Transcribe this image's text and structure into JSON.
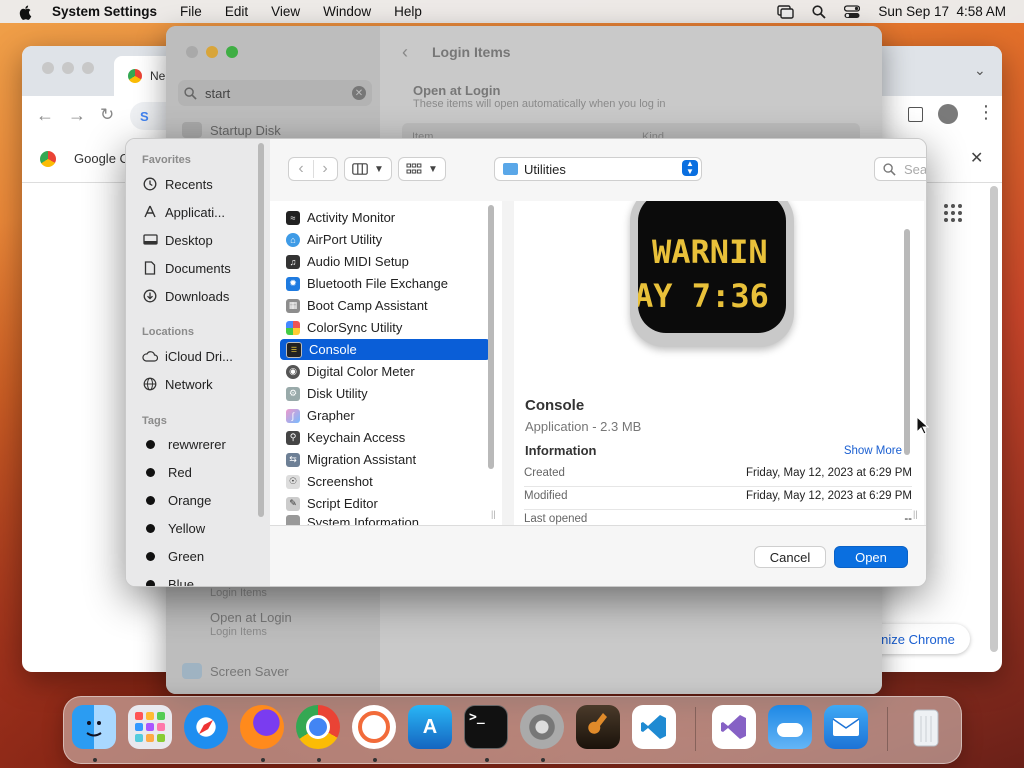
{
  "menubar": {
    "app_name": "System Settings",
    "menus": [
      "File",
      "Edit",
      "View",
      "Window",
      "Help"
    ],
    "datetime": "Sun Sep 17  4:58 AM"
  },
  "chrome": {
    "tab_title": "Ne",
    "bookmark_label": "Google C",
    "address_fragment": "S",
    "customize_button": "nize Chrome"
  },
  "settings": {
    "search_value": "start",
    "sidebar_items": [
      "Startup Disk",
      "Login Items",
      "Open at Login",
      "Login Items",
      "Screen Saver"
    ],
    "header_title": "Login Items",
    "section_title": "Open at Login",
    "section_subtitle": "These items will open automatically when you log in",
    "table_headers": [
      "Item",
      "Kind"
    ]
  },
  "dialog": {
    "sidebar": {
      "favorites_heading": "Favorites",
      "favorites": [
        {
          "label": "Recents",
          "icon": "clock-icon"
        },
        {
          "label": "Applicati...",
          "icon": "applications-icon"
        },
        {
          "label": "Desktop",
          "icon": "desktop-icon"
        },
        {
          "label": "Documents",
          "icon": "document-icon"
        },
        {
          "label": "Downloads",
          "icon": "download-icon"
        }
      ],
      "locations_heading": "Locations",
      "locations": [
        {
          "label": "iCloud Dri...",
          "icon": "cloud-icon"
        },
        {
          "label": "Network",
          "icon": "globe-icon"
        }
      ],
      "tags_heading": "Tags",
      "tags": [
        "rewwrerer",
        "Red",
        "Orange",
        "Yellow",
        "Green",
        "Blue"
      ]
    },
    "toolbar": {
      "location": "Utilities",
      "search_placeholder": "Search"
    },
    "files": [
      "Activity Monitor",
      "AirPort Utility",
      "Audio MIDI Setup",
      "Bluetooth File Exchange",
      "Boot Camp Assistant",
      "ColorSync Utility",
      "Console",
      "Digital Color Meter",
      "Disk Utility",
      "Grapher",
      "Keychain Access",
      "Migration Assistant",
      "Screenshot",
      "Script Editor",
      "System Information"
    ],
    "selected_file": "Console",
    "preview": {
      "icon_line1": "WARNIN",
      "icon_line2": "AY 7:36",
      "name": "Console",
      "kind_size": "Application - 2.3 MB",
      "info_heading": "Information",
      "show_more": "Show More",
      "rows": [
        {
          "label": "Created",
          "value": "Friday, May 12, 2023 at 6:29 PM"
        },
        {
          "label": "Modified",
          "value": "Friday, May 12, 2023 at 6:29 PM"
        },
        {
          "label": "Last opened",
          "value": "--"
        }
      ]
    },
    "cancel_label": "Cancel",
    "open_label": "Open"
  },
  "dock": {
    "apps": [
      "Finder",
      "Launchpad",
      "Safari",
      "Firefox",
      "Chrome",
      "Postman",
      "App Store",
      "Terminal",
      "System Settings",
      "GarageBand",
      "Visual Studio Code",
      "Visual Studio",
      "Weather",
      "Mail",
      "Trash"
    ]
  },
  "colors": {
    "accent": "#0a5ed7",
    "selection": "#0a5ed7"
  }
}
